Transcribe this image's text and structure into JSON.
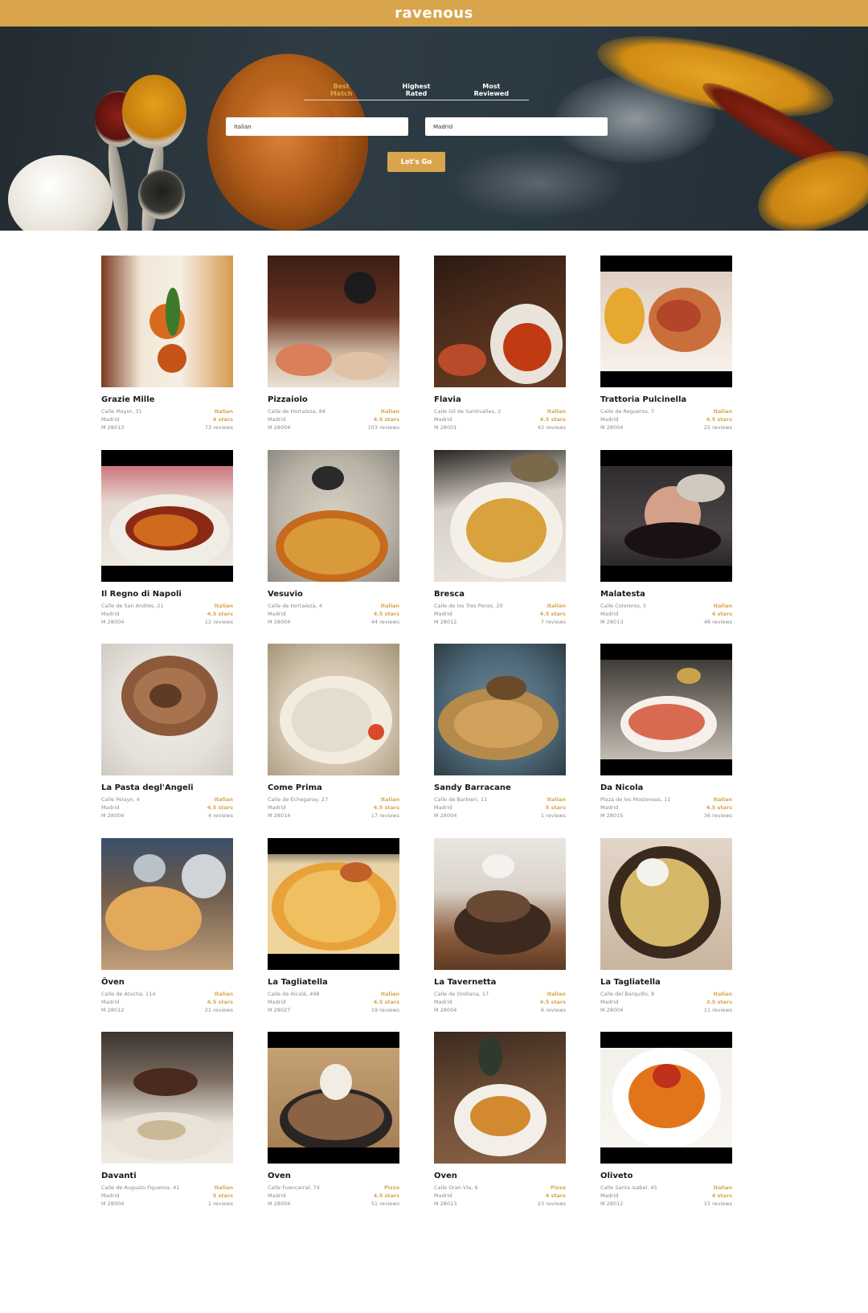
{
  "app": {
    "logo": "ravenous"
  },
  "sort_tabs": [
    {
      "label": "Best Match",
      "active": true
    },
    {
      "label": "Highest Rated",
      "active": false
    },
    {
      "label": "Most Reviewed",
      "active": false
    }
  ],
  "search": {
    "term_value": "Italian",
    "location_value": "Madrid",
    "button_label": "Let's Go"
  },
  "colors": {
    "accent": "#d9a54c",
    "topbar": "#d9a54c"
  },
  "businesses": [
    {
      "name": "Grazie Mille",
      "address": "Calle Mayor, 31",
      "city": "Madrid",
      "zip": "M 28013",
      "category": "Italian",
      "rating": "4 stars",
      "reviews": "73 reviews"
    },
    {
      "name": "Pizzaiolo",
      "address": "Calle de Hortaleza, 84",
      "city": "Madrid",
      "zip": "M 28004",
      "category": "Italian",
      "rating": "4.5 stars",
      "reviews": "103 reviews"
    },
    {
      "name": "Flavia",
      "address": "Calle Gil de Santivañes, 2",
      "city": "Madrid",
      "zip": "M 28001",
      "category": "Italian",
      "rating": "4.5 stars",
      "reviews": "43 reviews"
    },
    {
      "name": "Trattoria Pulcinella",
      "address": "Calle de Regueros, 7",
      "city": "Madrid",
      "zip": "M 28004",
      "category": "Italian",
      "rating": "4.5 stars",
      "reviews": "25 reviews"
    },
    {
      "name": "Il Regno di Napoli",
      "address": "Calle de San Andrés, 21",
      "city": "Madrid",
      "zip": "M 28004",
      "category": "Italian",
      "rating": "4.5 stars",
      "reviews": "12 reviews"
    },
    {
      "name": "Vesuvio",
      "address": "Calle de Hortaleza, 4",
      "city": "Madrid",
      "zip": "M 28004",
      "category": "Italian",
      "rating": "4.5 stars",
      "reviews": "44 reviews"
    },
    {
      "name": "Bresca",
      "address": "Calle de los Tres Peces, 20",
      "city": "Madrid",
      "zip": "M 28012",
      "category": "Italian",
      "rating": "4.5 stars",
      "reviews": "7 reviews"
    },
    {
      "name": "Malatesta",
      "address": "Calle Coloreros, 5",
      "city": "Madrid",
      "zip": "M 28013",
      "category": "Italian",
      "rating": "4 stars",
      "reviews": "48 reviews"
    },
    {
      "name": "La Pasta degl'Angeli",
      "address": "Calle Pelayo, 4",
      "city": "Madrid",
      "zip": "M 28004",
      "category": "Italian",
      "rating": "4.5 stars",
      "reviews": "4 reviews"
    },
    {
      "name": "Come Prima",
      "address": "Calle de Echegaray, 27",
      "city": "Madrid",
      "zip": "M 28014",
      "category": "Italian",
      "rating": "4.5 stars",
      "reviews": "17 reviews"
    },
    {
      "name": "Sandy Barracane",
      "address": "Calle de Barbieri, 11",
      "city": "Madrid",
      "zip": "M 28004",
      "category": "Italian",
      "rating": "5 stars",
      "reviews": "1 reviews"
    },
    {
      "name": "Da Nicola",
      "address": "Plaza de los Mostenses, 11",
      "city": "Madrid",
      "zip": "M 28015",
      "category": "Italian",
      "rating": "4.5 stars",
      "reviews": "36 reviews"
    },
    {
      "name": "Ôven",
      "address": "Calle de Atocha, 114",
      "city": "Madrid",
      "zip": "M 28012",
      "category": "Italian",
      "rating": "4.5 stars",
      "reviews": "21 reviews"
    },
    {
      "name": "La Tagliatella",
      "address": "Calle de Alcalá, 498",
      "city": "Madrid",
      "zip": "M 28027",
      "category": "Italian",
      "rating": "4.5 stars",
      "reviews": "19 reviews"
    },
    {
      "name": "La Tavernetta",
      "address": "Calle de Orellana, 17",
      "city": "Madrid",
      "zip": "M 28004",
      "category": "Italian",
      "rating": "4.5 stars",
      "reviews": "6 reviews"
    },
    {
      "name": "La Tagliatella",
      "address": "Calle del Barquillo, 8",
      "city": "Madrid",
      "zip": "M 28004",
      "category": "Italian",
      "rating": "3.5 stars",
      "reviews": "11 reviews"
    },
    {
      "name": "Davanti",
      "address": "Calle de Augusto Figueroa, 41",
      "city": "Madrid",
      "zip": "M 28004",
      "category": "Italian",
      "rating": "5 stars",
      "reviews": "1 reviews"
    },
    {
      "name": "Oven",
      "address": "Calle Fuencarral, 74",
      "city": "Madrid",
      "zip": "M 28004",
      "category": "Pizza",
      "rating": "4.5 stars",
      "reviews": "51 reviews"
    },
    {
      "name": "Oven",
      "address": "Calle Gran Vía, 6",
      "city": "Madrid",
      "zip": "M 28013",
      "category": "Pizza",
      "rating": "4 stars",
      "reviews": "23 reviews"
    },
    {
      "name": "Oliveto",
      "address": "Calle Santa Isabel, 45",
      "city": "Madrid",
      "zip": "M 28012",
      "category": "Italian",
      "rating": "4 stars",
      "reviews": "15 reviews"
    }
  ]
}
